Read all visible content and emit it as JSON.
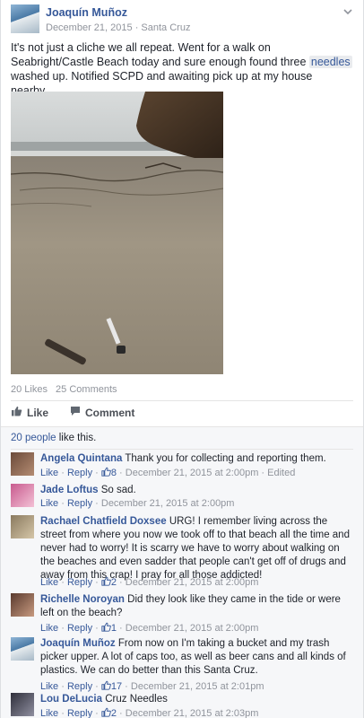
{
  "post": {
    "author": "Joaquín Muñoz",
    "date": "December 21, 2015",
    "separator": "·",
    "location": "Santa Cruz",
    "chevron_icon": "chevron-down-icon",
    "text_before": "It's not just a cliche we all repeat. Went for a walk on Seabright/Castle Beach today and sure enough found three ",
    "text_highlight": "needles",
    "text_after": " washed up. Notified SCPD and awaiting pick up at my house nearby...",
    "likes_count": "20 Likes",
    "comments_count": "25 Comments",
    "like_label": "Like",
    "comment_label": "Comment"
  },
  "likes_summary": {
    "link": "20 people",
    "rest": " like this."
  },
  "comment_meta": {
    "like": "Like",
    "dot": " · ",
    "reply": "Reply"
  },
  "comments": [
    {
      "name": "Angela Quintana",
      "text": "Thank you for collecting and reporting them.",
      "likes": "8",
      "time": "December 21, 2015 at 2:00pm",
      "edited": "Edited"
    },
    {
      "name": "Jade Loftus",
      "text": "So sad.",
      "time": "December 21, 2015 at 2:00pm"
    },
    {
      "name": "Rachael Chatfield Doxsee",
      "text": "URG! I remember living across the street from where you now we took off to that beach all the time and never had to worry! It is scarry we have to worry about walking on the beaches and even sadder that people can't get off of drugs and away from this crap! I pray for all those addicted!",
      "likes": "2",
      "time": "December 21, 2015 at 2:00pm"
    },
    {
      "name": "Richelle Noroyan",
      "text": "Did they look like they came in the tide or were left on the beach?",
      "likes": "1",
      "time": "December 21, 2015 at 2:00pm"
    },
    {
      "name": "Joaquín Muñoz",
      "text": "From now on I'm taking a bucket and my trash picker upper. A lot of caps too, as well as beer cans and all kinds of plastics. We can do better than this Santa Cruz.",
      "likes": "17",
      "time": "December 21, 2015 at 2:01pm"
    },
    {
      "name": "Lou DeLucia",
      "text": "Cruz Needles",
      "likes": "2",
      "time": "December 21, 2015 at 2:03pm"
    }
  ],
  "colors": {
    "link": "#365899",
    "muted": "#90949c",
    "comment_bg": "#f6f7f9"
  }
}
